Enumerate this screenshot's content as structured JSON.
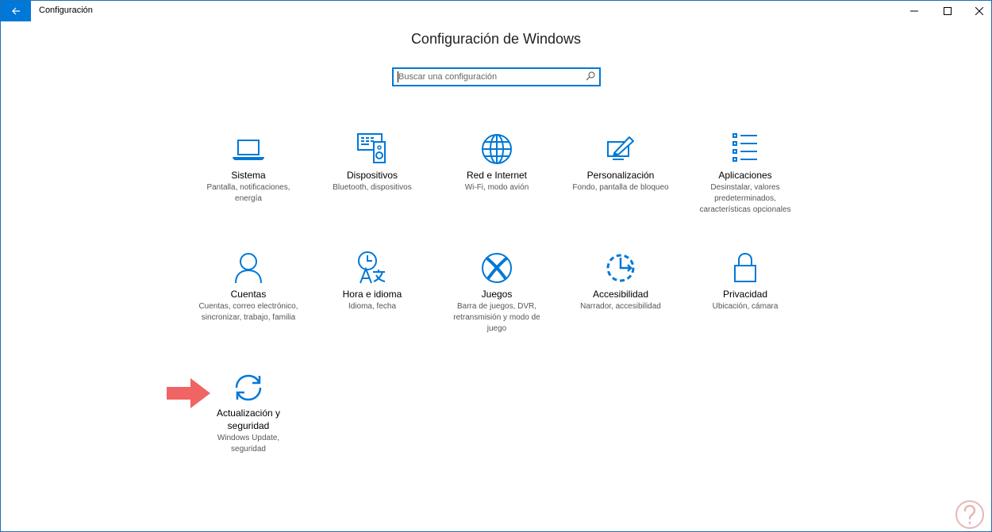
{
  "window": {
    "title": "Configuración",
    "accent": "#0078d7"
  },
  "main": {
    "title": "Configuración de Windows"
  },
  "search": {
    "placeholder": "Buscar una configuración",
    "value": ""
  },
  "tiles": [
    {
      "label": "Sistema",
      "desc": "Pantalla, notificaciones, energía",
      "icon": "laptop-icon"
    },
    {
      "label": "Dispositivos",
      "desc": "Bluetooth, dispositivos",
      "icon": "devices-icon"
    },
    {
      "label": "Red e Internet",
      "desc": "Wi-Fi, modo avión",
      "icon": "globe-icon"
    },
    {
      "label": "Personalización",
      "desc": "Fondo, pantalla de bloqueo",
      "icon": "paint-icon"
    },
    {
      "label": "Aplicaciones",
      "desc": "Desinstalar, valores predeterminados, características opcionales",
      "icon": "apps-list-icon"
    },
    {
      "label": "Cuentas",
      "desc": "Cuentas, correo electrónico, sincronizar, trabajo, familia",
      "icon": "person-icon"
    },
    {
      "label": "Hora e idioma",
      "desc": "Idioma, fecha",
      "icon": "time-language-icon"
    },
    {
      "label": "Juegos",
      "desc": "Barra de juegos, DVR, retransmisión y modo de juego",
      "icon": "xbox-icon"
    },
    {
      "label": "Accesibilidad",
      "desc": "Narrador, accesibilidad",
      "icon": "ease-of-access-icon"
    },
    {
      "label": "Privacidad",
      "desc": "Ubicación, cámara",
      "icon": "lock-icon"
    },
    {
      "label": "Actualización y seguridad",
      "desc": "Windows Update, seguridad",
      "icon": "sync-icon"
    }
  ],
  "annotation": {
    "arrow_color": "#f06464"
  }
}
